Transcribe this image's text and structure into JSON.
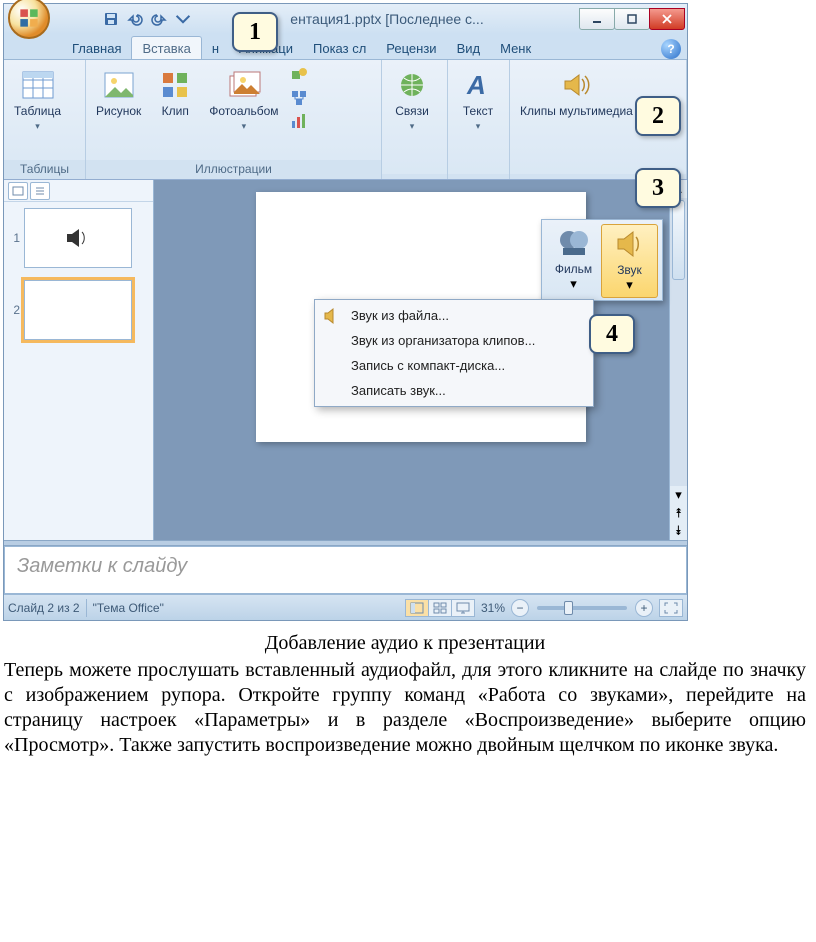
{
  "title": "ентация1.pptx [Последнее с...",
  "tabs": [
    "Главная",
    "Вставка",
    "н",
    "Анимаци",
    "Показ сл",
    "Рецензи",
    "Вид",
    "Менк"
  ],
  "active_tab_index": 1,
  "ribbon": {
    "group_tables": {
      "label": "Таблицы",
      "table_btn": "Таблица"
    },
    "group_illustrations": {
      "label": "Иллюстрации",
      "picture": "Рисунок",
      "clip": "Клип",
      "photoalbum": "Фотоальбом"
    },
    "group_links": {
      "links": "Связи"
    },
    "group_text": {
      "text": "Текст"
    },
    "group_media": {
      "media": "Клипы мультимедиа"
    }
  },
  "slide_panel": {
    "thumbs": [
      {
        "num": "1",
        "has_speaker": true,
        "selected": false
      },
      {
        "num": "2",
        "has_speaker": false,
        "selected": true
      }
    ]
  },
  "media_popup": {
    "film": "Фильм",
    "sound": "Звук"
  },
  "dropdown": {
    "items": [
      "Звук из файла...",
      "Звук из организатора клипов...",
      "Запись с компакт-диска...",
      "Записать звук..."
    ]
  },
  "notes_placeholder": "Заметки к слайду",
  "statusbar": {
    "slide": "Слайд 2 из 2",
    "theme": "\"Тема Office\"",
    "zoom": "31%"
  },
  "callouts": {
    "c1": "1",
    "c2": "2",
    "c3": "3",
    "c4": "4"
  },
  "doc": {
    "caption": "Добавление аудио к презентации",
    "para": "Теперь можете прослушать вставленный аудиофайл, для этого кликните на слайде по значку с изображением рупора. Откройте группу команд «Работа со звуками», перейдите на страницу настроек «Параметры» и в разделе «Воспроизведение» выберите опцию «Просмотр». Также запустить воспроизведение можно двойным щелчком по иконке звука."
  }
}
